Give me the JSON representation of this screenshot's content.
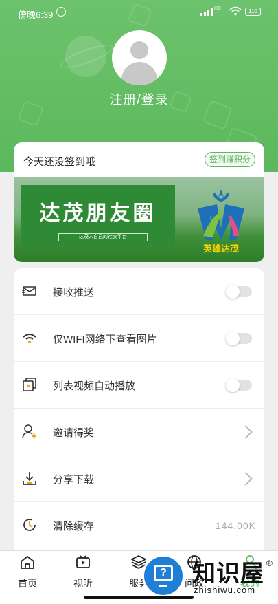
{
  "status_bar": {
    "time": "傍晚6:39",
    "network": "HD",
    "battery": "110"
  },
  "profile": {
    "login_label": "注册/登录"
  },
  "checkin": {
    "text": "今天还没签到哦",
    "button": "签到赚积分"
  },
  "banner": {
    "title": "达茂朋友圈",
    "subtitle": "达茂人自己的社交平台",
    "logo_text": "英雄达茂"
  },
  "settings": [
    {
      "label": "接收推送",
      "control": "toggle",
      "on": false
    },
    {
      "label": "仅WIFI网络下查看图片",
      "control": "toggle",
      "on": false
    },
    {
      "label": "列表视频自动播放",
      "control": "toggle",
      "on": false
    },
    {
      "label": "邀请得奖",
      "control": "chevron"
    },
    {
      "label": "分享下载",
      "control": "chevron"
    },
    {
      "label": "清除缓存",
      "control": "value",
      "value": "144.00K"
    }
  ],
  "tabs": [
    {
      "label": "首页",
      "icon": "home-icon"
    },
    {
      "label": "视听",
      "icon": "video-icon"
    },
    {
      "label": "服务",
      "icon": "layers-icon"
    },
    {
      "label": "问政",
      "icon": "globe-icon"
    },
    {
      "label": "我的",
      "icon": "user-icon",
      "active": true
    }
  ],
  "watermark": {
    "text": "知识屋",
    "url": "zhishiwu.com",
    "mark": "®"
  },
  "colors": {
    "accent": "#5cb85c",
    "watermark_blue": "#1f7fd6"
  }
}
